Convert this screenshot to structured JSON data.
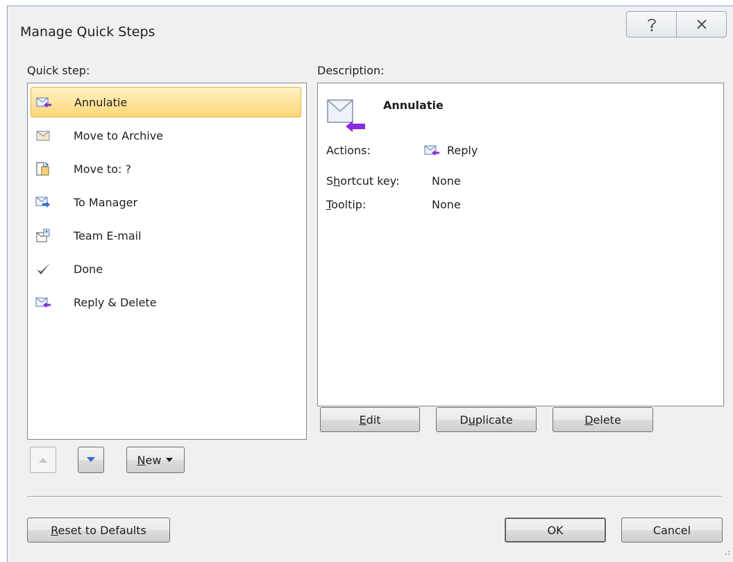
{
  "window": {
    "title": "Manage Quick Steps",
    "help_glyph": "?",
    "close_glyph": "✕"
  },
  "quick_step_panel": {
    "label": "Quick step:",
    "items": [
      {
        "label": "Annulatie",
        "icon": "reply-delete-icon",
        "selected": true
      },
      {
        "label": "Move to Archive",
        "icon": "envelope-icon",
        "selected": false
      },
      {
        "label": "Move to: ?",
        "icon": "move-folder-icon",
        "selected": false
      },
      {
        "label": "To Manager",
        "icon": "forward-icon",
        "selected": false
      },
      {
        "label": "Team E-mail",
        "icon": "team-email-icon",
        "selected": false
      },
      {
        "label": "Done",
        "icon": "checkmark-icon",
        "selected": false
      },
      {
        "label": "Reply & Delete",
        "icon": "reply-delete-icon",
        "selected": false
      }
    ],
    "new_button_label": "New"
  },
  "description_panel": {
    "label": "Description:",
    "title": "Annulatie",
    "actions_label": "Actions:",
    "actions_value": "Reply",
    "shortcut_label_pre": "S",
    "shortcut_label_ul": "h",
    "shortcut_label_post": "ortcut key:",
    "shortcut_value": "None",
    "tooltip_label_ul": "T",
    "tooltip_label_post": "ooltip:",
    "tooltip_value": "None"
  },
  "buttons": {
    "edit_ul": "E",
    "edit_rest": "dit",
    "duplicate_pre": "D",
    "duplicate_ul": "u",
    "duplicate_post": "plicate",
    "delete_ul": "D",
    "delete_rest": "elete",
    "new_ul": "N",
    "new_rest": "ew",
    "reset_ul": "R",
    "reset_rest": "eset to Defaults",
    "ok": "OK",
    "cancel": "Cancel"
  },
  "colors": {
    "selection": "#fcd777",
    "arrow_blue": "#2f6fd6",
    "purple_arrow": "#8a2be2",
    "dialog_bg": "#f0f0f0"
  }
}
